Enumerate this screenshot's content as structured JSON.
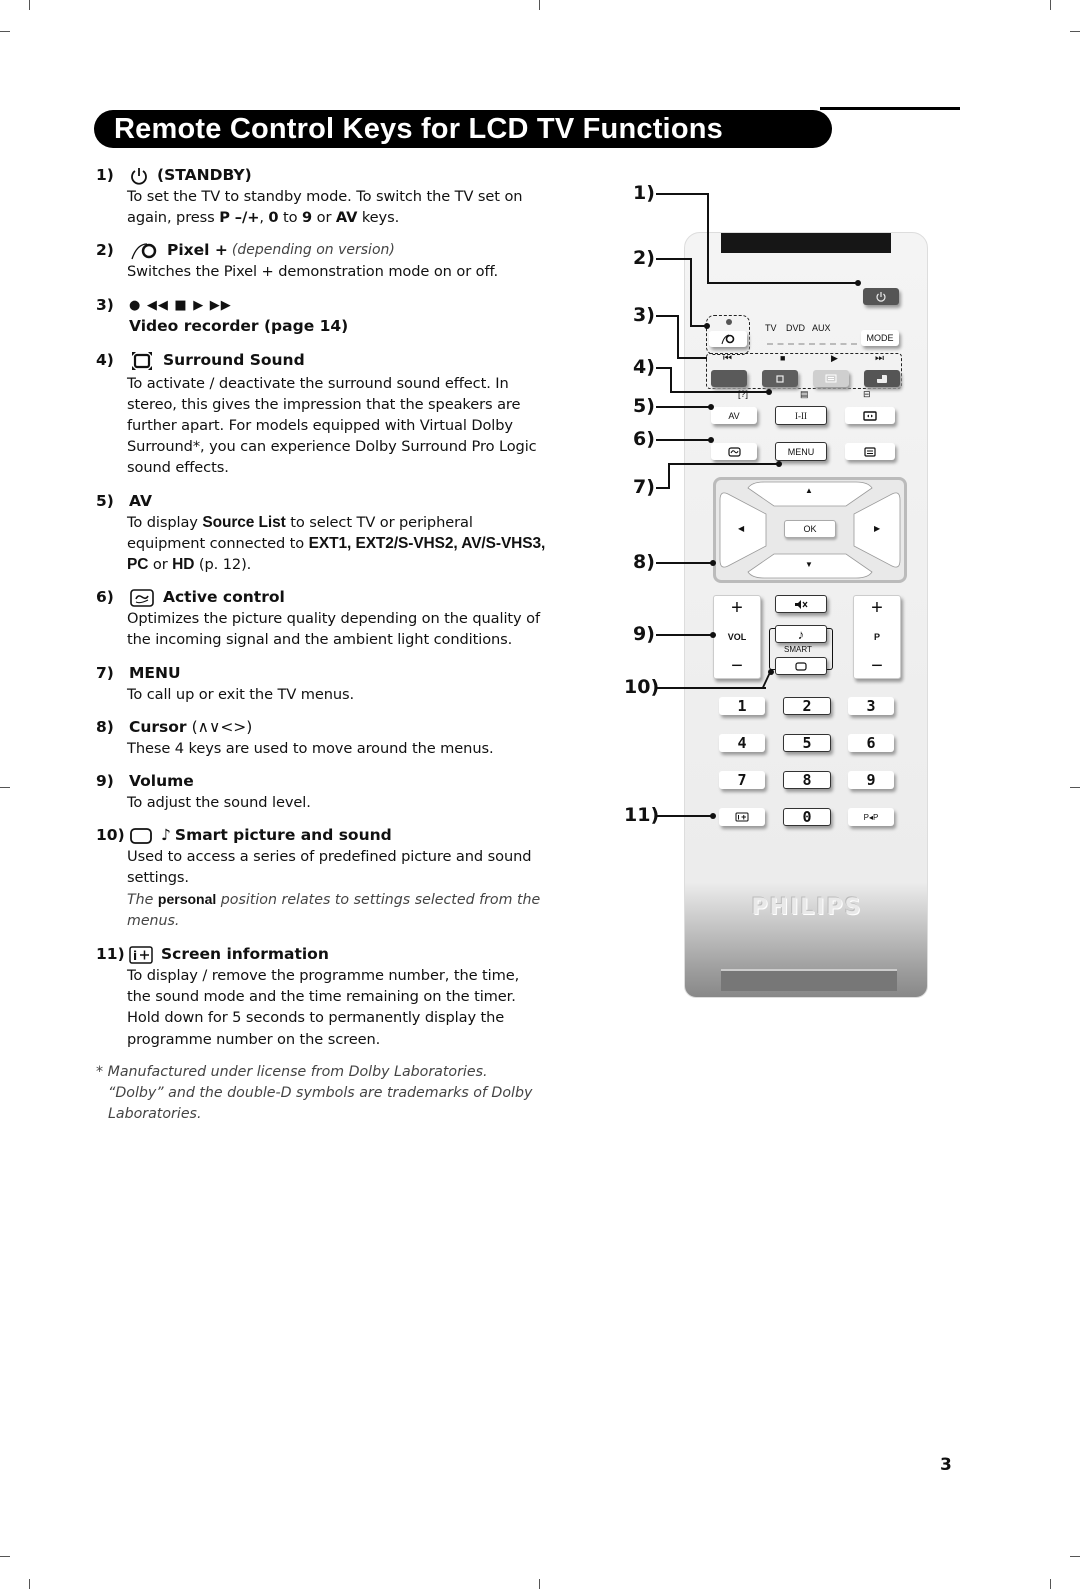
{
  "page": {
    "title": "Remote Control Keys for LCD TV Functions",
    "page_number": "3"
  },
  "items": [
    {
      "num": "1)",
      "icon": "power-icon",
      "title": "(STANDBY)",
      "body_parts": [
        "To set the TV to standby mode. To switch the TV set on again, press ",
        "P –/+",
        ", ",
        "0",
        " to ",
        "9",
        " or ",
        "AV",
        " keys."
      ]
    },
    {
      "num": "2)",
      "icon": "pixel-plus-icon",
      "title": "Pixel +",
      "subtitle": "(depending on version)",
      "body": "Switches the Pixel + demonstration mode on or off."
    },
    {
      "num": "3)",
      "icon_glyphs": "● ◀◀ ■ ▶ ▶▶",
      "title": "Video recorder (page 14)"
    },
    {
      "num": "4)",
      "icon": "surround-sound-icon",
      "title": "Surround Sound",
      "body": "To activate / deactivate the surround sound effect. In stereo, this gives the impression that the speakers are further apart. For models equipped with Virtual Dolby Surround*, you can experience Dolby Surround Pro Logic sound effects."
    },
    {
      "num": "5)",
      "title": "AV",
      "body_parts": [
        "To display ",
        "Source List",
        " to select TV or peripheral equipment connected to ",
        "EXT1, EXT2/S-VHS2, AV/S-VHS3, PC",
        " or ",
        "HD",
        " (p. 12)."
      ]
    },
    {
      "num": "6)",
      "icon": "active-control-icon",
      "title": "Active control",
      "body": "Optimizes the picture quality depending on the quality of the incoming signal and the ambient light conditions."
    },
    {
      "num": "7)",
      "title": "MENU",
      "body": "To call up or exit the TV menus."
    },
    {
      "num": "8)",
      "title": "Cursor",
      "title_suffix": "(∧∨<>)",
      "body": "These 4 keys are used to move around the menus."
    },
    {
      "num": "9)",
      "title": "Volume",
      "body": "To adjust the sound level."
    },
    {
      "num": "10)",
      "icon": "smart-picture-icon",
      "icon2": "♪",
      "title": "Smart picture and sound",
      "body": "Used to access a series of predefined picture and sound settings.",
      "note_parts": [
        "The ",
        "personal",
        " position relates to settings selected from the menus."
      ]
    },
    {
      "num": "11)",
      "icon": "screen-info-icon",
      "title": "Screen information",
      "body": "To display / remove the programme number, the time, the sound mode and the time remaining on the timer. Hold down for 5 seconds to permanently display the programme number on the screen."
    }
  ],
  "footnote": "* Manufactured under license from Dolby Laboratories. “Dolby” and the double-D symbols are trademarks of Dolby Laboratories.",
  "remote": {
    "callouts": [
      "1)",
      "2)",
      "3)",
      "4)",
      "5)",
      "6)",
      "7)",
      "8)",
      "9)",
      "10)",
      "11)"
    ],
    "mode_labels": [
      "TV",
      "DVD",
      "AUX"
    ],
    "mode_key": "MODE",
    "transport": [
      "⏮",
      "■",
      "▶",
      "⏭"
    ],
    "av_key": "AV",
    "dual_key": "I-II",
    "menu_key": "MENU",
    "ok_key": "OK",
    "vol_label": "VOL",
    "prog_label": "P",
    "smart_label": "SMART",
    "plus": "+",
    "minus": "−",
    "note": "♪",
    "mute": "🔇",
    "digits": [
      "1",
      "2",
      "3",
      "4",
      "5",
      "6",
      "7",
      "8",
      "9",
      "0"
    ],
    "pip_key": "P◂P",
    "brand": "PHILIPS",
    "cursor": {
      "up": "▲",
      "down": "▼",
      "left": "◀",
      "right": "▶"
    }
  }
}
